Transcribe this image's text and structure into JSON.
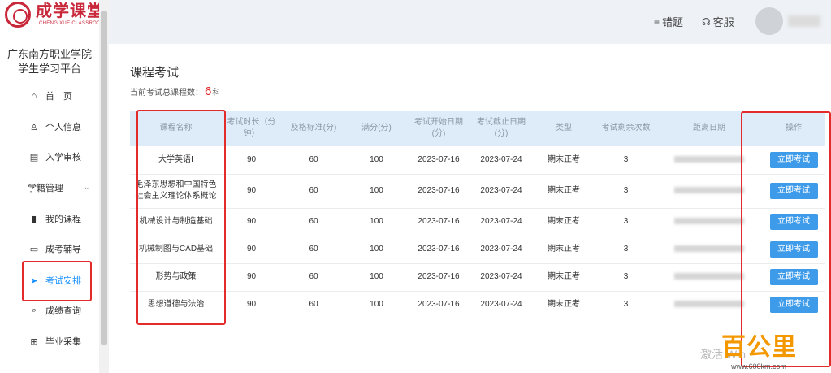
{
  "logo": {
    "name": "成学课堂",
    "sub": "CHENG XUE CLASSROOM"
  },
  "school": {
    "line1": "广东南方职业学院",
    "line2": "学生学习平台"
  },
  "nav": [
    {
      "label": "首　页",
      "icon": "home-icon",
      "glyph": "⌂"
    },
    {
      "label": "个人信息",
      "icon": "user-icon",
      "glyph": "♙"
    },
    {
      "label": "入学审核",
      "icon": "id-card-icon",
      "glyph": "▤"
    },
    {
      "label": "学籍管理",
      "icon": "chevron-down-icon",
      "glyph": "⌄"
    },
    {
      "label": "我的课程",
      "icon": "book-icon",
      "glyph": "▮"
    },
    {
      "label": "成考辅导",
      "icon": "monitor-icon",
      "glyph": "▭"
    },
    {
      "label": "考试安排",
      "icon": "paper-plane-icon",
      "glyph": "➤"
    },
    {
      "label": "成绩查询",
      "icon": "search-icon",
      "glyph": "⌕"
    },
    {
      "label": "毕业采集",
      "icon": "plus-square-icon",
      "glyph": "⊞"
    }
  ],
  "header": {
    "mistakes": {
      "label": "错题",
      "glyph": "≡"
    },
    "service": {
      "label": "客服",
      "glyph": "☊"
    }
  },
  "page": {
    "title": "课程考试",
    "summary_prefix": "当前考试总课程数：",
    "summary_count": "6",
    "summary_suffix": "科"
  },
  "table": {
    "headers": [
      "课程名称",
      "考试时长（分钟）",
      "及格标准(分)",
      "满分(分)",
      "考试开始日期(分)",
      "考试截止日期(分)",
      "类型",
      "考试剩余次数",
      "距离日期",
      "操作"
    ],
    "rows": [
      {
        "name": "大学英语Ⅰ",
        "duration": "90",
        "pass": "60",
        "full": "100",
        "start": "2023-07-16",
        "end": "2023-07-24",
        "type": "期末正考",
        "remaining": "3",
        "action": "立即考试"
      },
      {
        "name": "毛泽东思想和中国特色社会主义理论体系概论",
        "duration": "90",
        "pass": "60",
        "full": "100",
        "start": "2023-07-16",
        "end": "2023-07-24",
        "type": "期末正考",
        "remaining": "3",
        "action": "立即考试"
      },
      {
        "name": "机械设计与制造基础",
        "duration": "90",
        "pass": "60",
        "full": "100",
        "start": "2023-07-16",
        "end": "2023-07-24",
        "type": "期末正考",
        "remaining": "3",
        "action": "立即考试"
      },
      {
        "name": "机械制图与CAD基础",
        "duration": "90",
        "pass": "60",
        "full": "100",
        "start": "2023-07-16",
        "end": "2023-07-24",
        "type": "期末正考",
        "remaining": "3",
        "action": "立即考试"
      },
      {
        "name": "形势与政策",
        "duration": "90",
        "pass": "60",
        "full": "100",
        "start": "2023-07-16",
        "end": "2023-07-24",
        "type": "期末正考",
        "remaining": "3",
        "action": "立即考试"
      },
      {
        "name": "思想道德与法治",
        "duration": "90",
        "pass": "60",
        "full": "100",
        "start": "2023-07-16",
        "end": "2023-07-24",
        "type": "期末正考",
        "remaining": "3",
        "action": "立即考试"
      }
    ]
  },
  "watermark": {
    "text": "激活 Win"
  },
  "brand": {
    "name": "百公里",
    "url": "www.600km.com"
  },
  "colors": {
    "accent": "#1890ff",
    "button": "#3d9bea",
    "highlight": "#e32b2b",
    "header_bg": "#ddecf8"
  }
}
